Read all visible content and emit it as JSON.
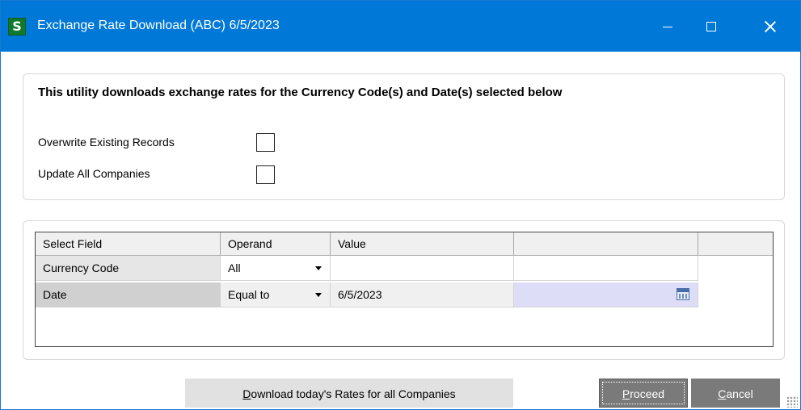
{
  "window": {
    "title": "Exchange Rate Download (ABC) 6/5/2023",
    "app_icon": "sage-s-icon",
    "controls": [
      "minimize-icon",
      "maximize-icon",
      "close-icon"
    ]
  },
  "options": {
    "heading": "This utility downloads exchange rates for the Currency Code(s) and Date(s) selected below",
    "overwrite_label": "Overwrite Existing Records",
    "overwrite_checked": false,
    "update_all_label": "Update All Companies",
    "update_all_checked": false
  },
  "grid": {
    "columns": [
      "Select Field",
      "Operand",
      "Value",
      ""
    ],
    "rows": [
      {
        "field": "Currency Code",
        "operand": "All",
        "value": "",
        "value2": ""
      },
      {
        "field": "Date",
        "operand": "Equal to",
        "value": "6/5/2023",
        "value2": ""
      }
    ]
  },
  "buttons": {
    "download_prefix": "",
    "download_hotkey": "D",
    "download_rest": "ownload today's Rates for all Companies",
    "proceed_hotkey": "P",
    "proceed_rest": "roceed",
    "cancel_hotkey": "C",
    "cancel_rest": "ancel"
  },
  "colors": {
    "titlebar": "#0078d7",
    "button_active": "#7a7a7a",
    "date_highlight": "#ddddf8"
  }
}
